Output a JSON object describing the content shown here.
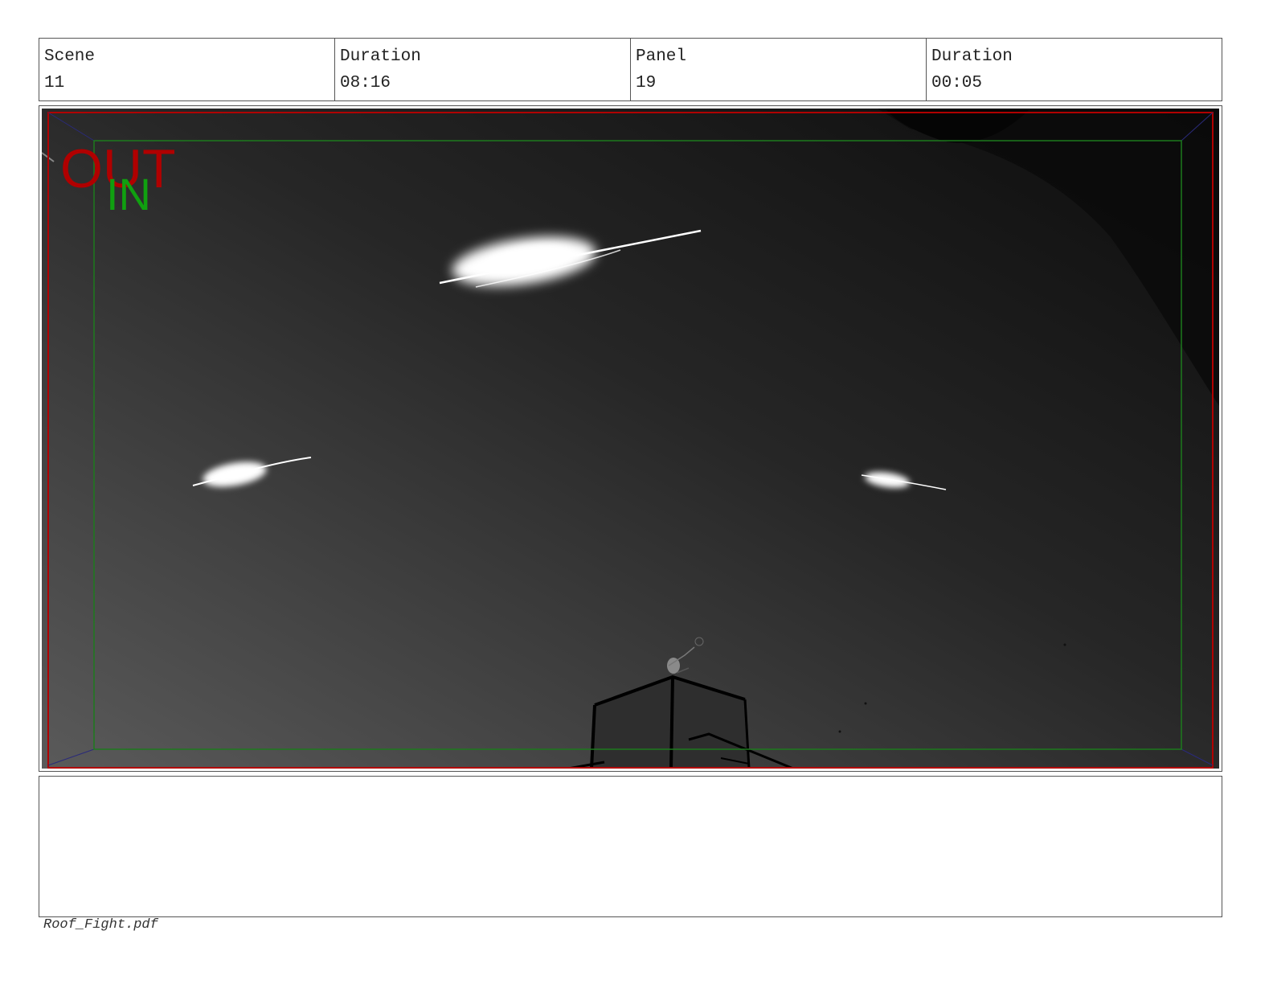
{
  "header": {
    "scene_label": "Scene",
    "scene_value": "11",
    "scene_duration_label": "Duration",
    "scene_duration_value": "08:16",
    "panel_label": "Panel",
    "panel_value": "19",
    "panel_duration_label": "Duration",
    "panel_duration_value": "00:05"
  },
  "frame": {
    "out_label": "OUT",
    "in_label": "IN",
    "out_color": "#b00000",
    "in_color": "#10a010"
  },
  "notes": {
    "text": ""
  },
  "footer": {
    "filename": "Roof_Fight.pdf"
  }
}
